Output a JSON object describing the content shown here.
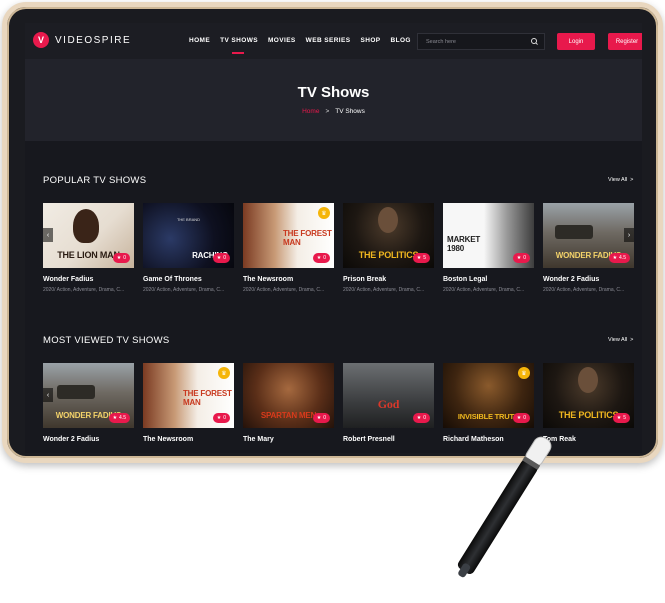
{
  "brand": {
    "name": "VIDEOSPIRE",
    "badge": "V"
  },
  "nav": {
    "items": [
      "HOME",
      "TV SHOWS",
      "MOVIES",
      "WEB SERIES",
      "SHOP",
      "BLOG"
    ],
    "active_index": 1
  },
  "search": {
    "placeholder": "Search here"
  },
  "auth": {
    "login": "Login",
    "register": "Register"
  },
  "hero": {
    "title": "TV Shows",
    "breadcrumb_home": "Home",
    "breadcrumb_sep": ">",
    "breadcrumb_current": "TV Shows"
  },
  "popular": {
    "title": "POPULAR TV SHOWS",
    "view_all": "View All",
    "arrow": ">",
    "cards": [
      {
        "name": "Wonder Fadius",
        "meta": "2020/ Action, Adventure, Drama, C...",
        "rating": "0",
        "poster_text": "THE LION MAN",
        "kicker": ""
      },
      {
        "name": "Game Of Thrones",
        "meta": "2020/ Action, Adventure, Drama, C...",
        "rating": "0",
        "poster_text": "RACHING",
        "kicker": "THE BRAND"
      },
      {
        "name": "The Newsroom",
        "meta": "2020/ Action, Adventure, Drama, C...",
        "rating": "0",
        "poster_text": "THE FOREST MAN",
        "kicker": ""
      },
      {
        "name": "Prison Break",
        "meta": "2020/ Action, Adventure, Drama, C...",
        "rating": "5",
        "poster_text": "THE POLITICS",
        "kicker": ""
      },
      {
        "name": "Boston Legal",
        "meta": "2020/ Action, Adventure, Drama, C...",
        "rating": "0",
        "poster_text": "MARKET 1980",
        "kicker": ""
      },
      {
        "name": "Wonder 2 Fadius",
        "meta": "2020/ Action, Adventure, Drama, C...",
        "rating": "4.5",
        "poster_text": "WONDER FADIUS",
        "kicker": ""
      }
    ]
  },
  "most_viewed": {
    "title": "MOST VIEWED TV SHOWS",
    "view_all": "View All",
    "arrow": ">",
    "cards": [
      {
        "name": "Wonder 2 Fadius",
        "rating": "4.5",
        "poster_text": "WONDER FADIUS"
      },
      {
        "name": "The Newsroom",
        "rating": "0",
        "poster_text": "THE FOREST MAN"
      },
      {
        "name": "The Mary",
        "rating": "0",
        "poster_text": "SPARTAN MEN"
      },
      {
        "name": "Robert Presnell",
        "rating": "0",
        "poster_text": "God"
      },
      {
        "name": "Richard Matheson",
        "rating": "0",
        "poster_text": "INVISIBLE TRUTH"
      },
      {
        "name": "Tom Reak",
        "rating": "5",
        "poster_text": "THE POLITICS"
      }
    ]
  },
  "colors": {
    "accent": "#e8194c",
    "background": "#17181e",
    "crown": "#f5b50a"
  }
}
